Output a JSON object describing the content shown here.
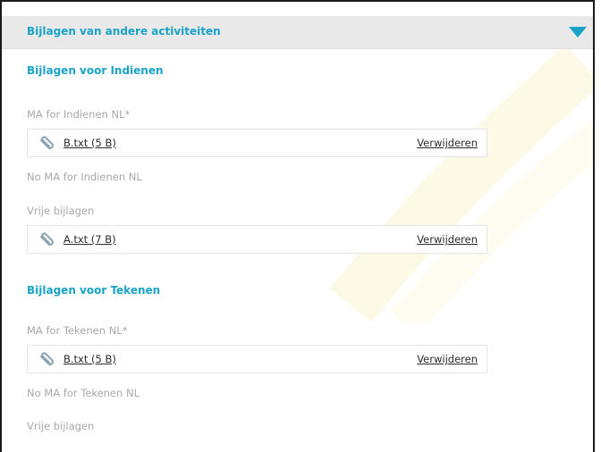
{
  "panel": {
    "title": "Bijlagen van andere activiteiten",
    "toggle_icon": "triangle-down-icon",
    "accent_color": "#1aa3c8"
  },
  "sections": [
    {
      "heading": "Bijlagen voor Indienen",
      "required_label": "MA for Indienen NL*",
      "required_file": {
        "name": "B.txt (5 B)",
        "remove_label": "Verwijderen"
      },
      "optional_label": "No MA for Indienen NL",
      "free_label": "Vrije bijlagen",
      "free_file": {
        "name": "A.txt (7 B)",
        "remove_label": "Verwijderen"
      }
    },
    {
      "heading": "Bijlagen voor Tekenen",
      "required_label": "MA for Tekenen NL*",
      "required_file": {
        "name": "B.txt (5 B)",
        "remove_label": "Verwijderen"
      },
      "optional_label": "No MA for Tekenen NL",
      "free_label": "Vrije bijlagen"
    }
  ]
}
